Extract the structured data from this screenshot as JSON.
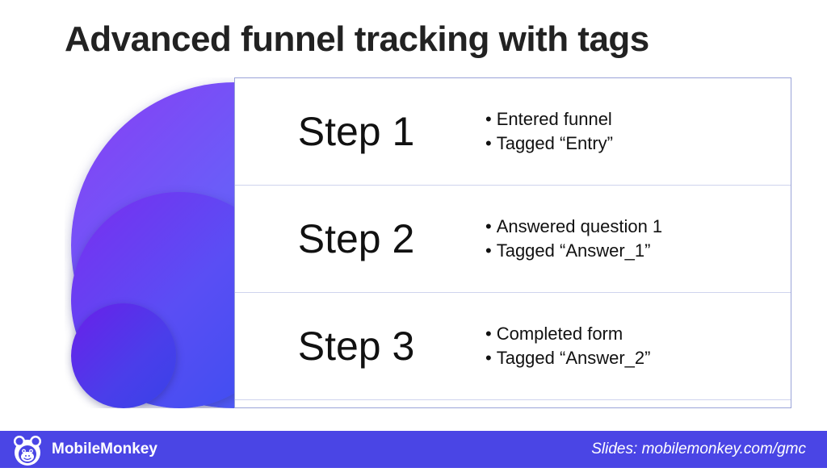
{
  "title": "Advanced funnel tracking with tags",
  "steps": [
    {
      "label": "Step 1",
      "bullets": [
        "Entered funnel",
        "Tagged “Entry”"
      ]
    },
    {
      "label": "Step 2",
      "bullets": [
        "Answered question 1",
        "Tagged “Answer_1”"
      ]
    },
    {
      "label": "Step 3",
      "bullets": [
        "Completed form",
        "Tagged “Answer_2”"
      ]
    }
  ],
  "footer": {
    "brand": "MobileMonkey",
    "slides_prefix": "Slides: ",
    "slides_url": "mobilemonkey.com/gmc"
  }
}
